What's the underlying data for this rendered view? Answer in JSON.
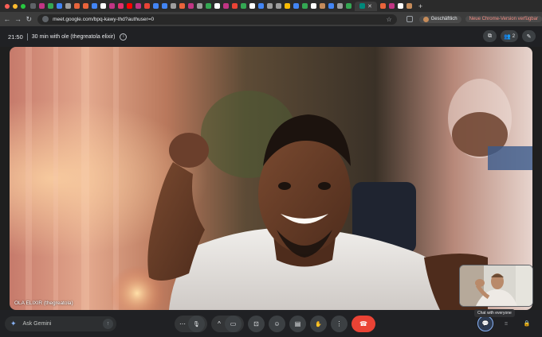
{
  "browser": {
    "url": "meet.google.com/bpq-kawy-thd?authuser=0",
    "profile_label": "Geschäftlich",
    "update_label": "Neue Chrome-Version verfügbar",
    "new_tab_symbol": "+"
  },
  "meeting": {
    "time": "21:50",
    "title": "30 min with ole (thegreatola elixir)",
    "participant_count": "2",
    "participant_name": "OLA ELIXIR (thegreatola)"
  },
  "gemini": {
    "label": "Ask Gemini"
  },
  "tooltip": {
    "chat": "Chat with everyone"
  },
  "colors": {
    "end_call": "#ea4335",
    "accent": "#8ab4f8"
  },
  "icons": {
    "more": "⋯",
    "mic": "🎙",
    "chevron": "^",
    "camera": "▭",
    "present": "⊡",
    "emoji": "☺",
    "captions": "▤",
    "hand": "✋",
    "more_vert": "⋮",
    "end": "☎",
    "chat": "💬",
    "apps": "⁝⁝",
    "lock": "🔒"
  }
}
